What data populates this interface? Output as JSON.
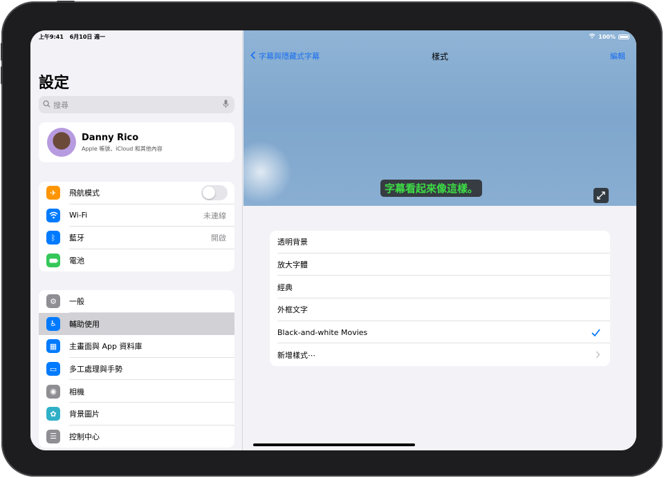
{
  "status_bar": {
    "time": "上午9:41",
    "date": "6月10日 週一",
    "battery": "100%"
  },
  "sidebar": {
    "title": "設定",
    "search_placeholder": "搜尋",
    "profile": {
      "name": "Danny Rico",
      "subtitle": "Apple 帳號、iCloud 和其他內容"
    },
    "group1": [
      {
        "label": "飛航模式",
        "icon": "airplane-icon",
        "color": "#ff9500",
        "value": ""
      },
      {
        "label": "Wi-Fi",
        "icon": "wifi-icon",
        "color": "#007aff",
        "value": "未連線"
      },
      {
        "label": "藍牙",
        "icon": "bluetooth-icon",
        "color": "#007aff",
        "value": "開啟"
      },
      {
        "label": "電池",
        "icon": "battery-icon",
        "color": "#34c759",
        "value": ""
      }
    ],
    "group2": [
      {
        "label": "一般",
        "icon": "gear-icon",
        "color": "#8e8e93"
      },
      {
        "label": "輔助使用",
        "icon": "accessibility-icon",
        "color": "#007aff"
      },
      {
        "label": "主畫面與 App 資料庫",
        "icon": "home-screen-icon",
        "color": "#007aff"
      },
      {
        "label": "多工處理與手勢",
        "icon": "multitasking-icon",
        "color": "#007aff"
      },
      {
        "label": "相機",
        "icon": "camera-icon",
        "color": "#8e8e93"
      },
      {
        "label": "背景圖片",
        "icon": "wallpaper-icon",
        "color": "#30b0c7"
      },
      {
        "label": "控制中心",
        "icon": "control-center-icon",
        "color": "#8e8e93"
      }
    ]
  },
  "main": {
    "back_label": "字幕與隱藏式字幕",
    "title": "樣式",
    "edit_label": "編輯",
    "caption_preview": "字幕看起來像這樣。",
    "styles": [
      {
        "label": "透明背景",
        "selected": false
      },
      {
        "label": "放大字體",
        "selected": false
      },
      {
        "label": "經典",
        "selected": false
      },
      {
        "label": "外框文字",
        "selected": false
      },
      {
        "label": "Black-and-white Movies",
        "selected": true
      },
      {
        "label": "新增樣式⋯",
        "selected": false
      }
    ]
  },
  "colors": {
    "accent": "#007aff",
    "caption_text": "#3ddc46"
  }
}
